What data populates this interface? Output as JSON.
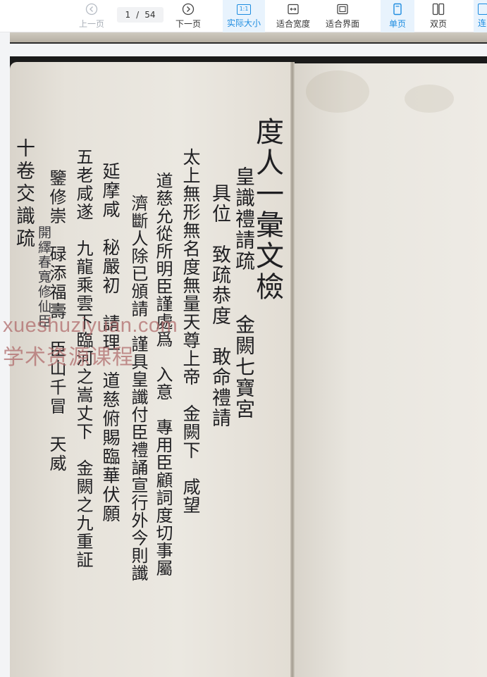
{
  "toolbar": {
    "prev_label": "上一页",
    "next_label": "下一页",
    "current_page": "1",
    "page_separator": "/",
    "total_pages": "54",
    "actual_size_label": "实际大小",
    "actual_size_icon_text": "1:1",
    "fit_width_label": "适合宽度",
    "fit_page_label": "适合界面",
    "single_page_label": "单页",
    "double_page_label": "双页",
    "continuous_label": "连"
  },
  "document": {
    "columns": [
      "度人一彙文檢",
      "皇識禮請疏　　金闕七寶宮",
      "具位　致疏恭度　敢命禮請",
      "太上無形無名度無量天尊上帝　金闕下　咸望",
      "道慈允從所明臣謹處爲　入意　專用臣顧詞度切事屬",
      "濟斷人除已頒請　謹具皇讖付臣禮誦宣行外今則讖",
      "延摩咸　秘嚴初　請理　道慈俯賜臨華伏願",
      "五老咸遂　九龍乘雲下臨河之嵩丈下　金闕之九重証",
      "鑒修崇　碌添福壽　臣山千冒　天威",
      "開繹春寬修仙臣",
      "十卷交識疏"
    ]
  },
  "watermark": {
    "line1": "xueshuziyuan.com",
    "line2": "学术资源课程"
  }
}
